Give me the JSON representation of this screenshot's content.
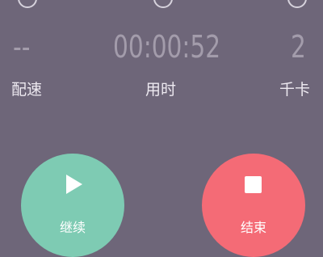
{
  "stats": {
    "pace": {
      "value": "--",
      "label": "配速"
    },
    "duration": {
      "value": "00:00:52",
      "label": "用时"
    },
    "calories": {
      "value": "2",
      "label": "千卡"
    }
  },
  "actions": {
    "continue_label": "继续",
    "end_label": "结束",
    "continue_color": "#7ecbb3",
    "end_color": "#f46b76"
  },
  "icons": {
    "top_left": "circle-icon",
    "top_center": "circle-icon",
    "top_right": "circle-icon",
    "continue": "play-icon",
    "end": "stop-icon"
  }
}
